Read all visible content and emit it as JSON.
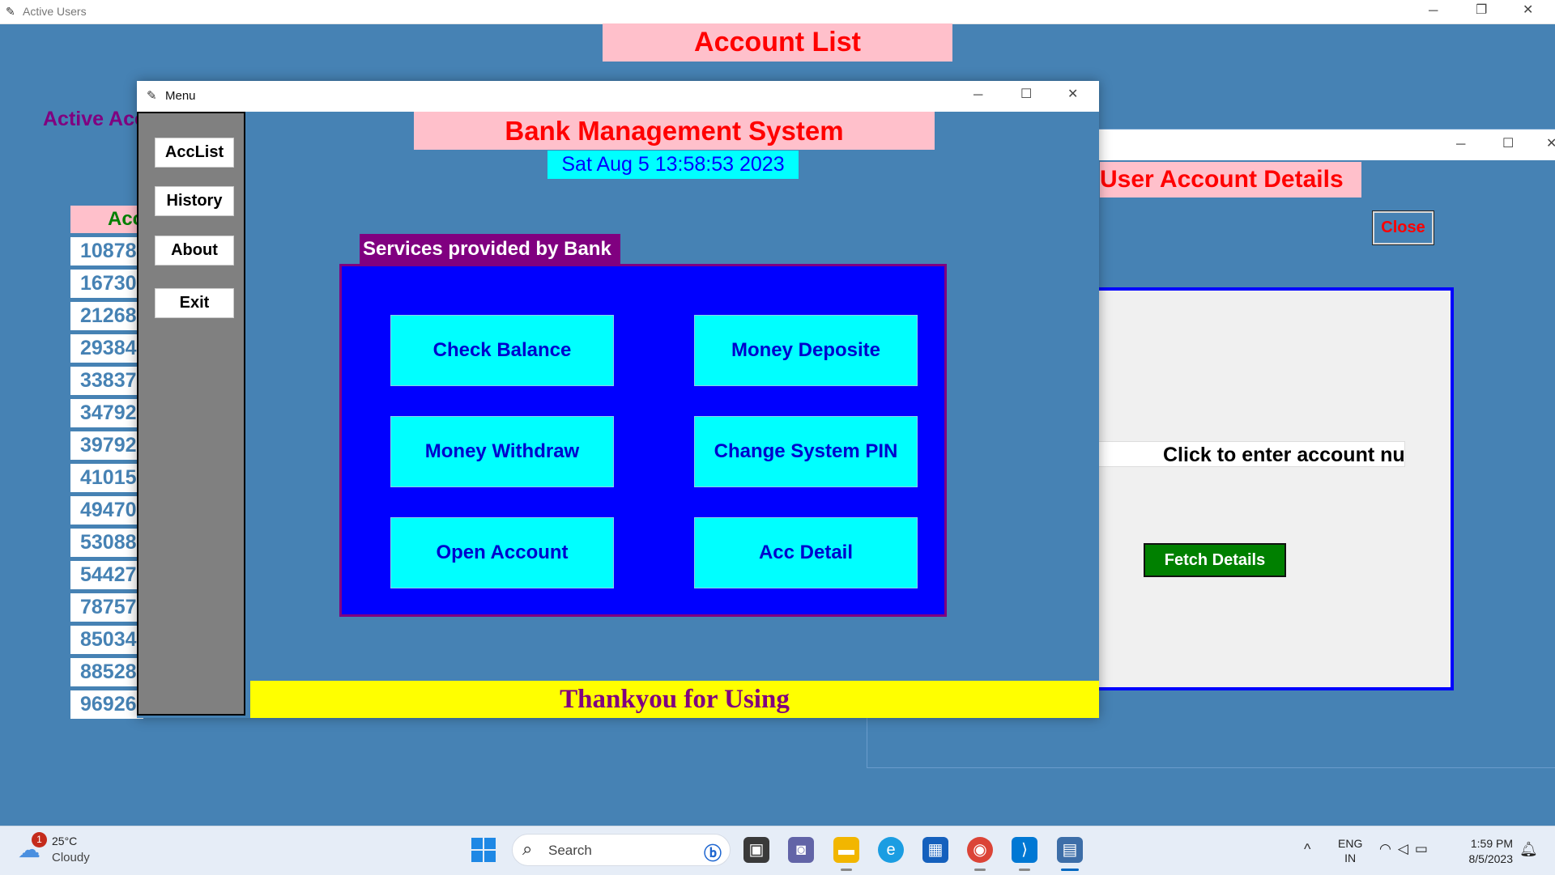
{
  "bg_window": {
    "title": "Active Users",
    "heading": "Account List",
    "active_label": "Active Acc",
    "table": {
      "header": "Acc",
      "rows": [
        "10878",
        "16730",
        "21268",
        "29384",
        "33837",
        "34792",
        "39792",
        "41015",
        "49470",
        "53088",
        "54427",
        "78757",
        "85034",
        "88528",
        "96926"
      ]
    }
  },
  "uad_window": {
    "heading": "User Account Details",
    "close_label": "Close",
    "input_value": "Click to enter account number",
    "fetch_label": "Fetch Details"
  },
  "menu_window": {
    "title": "Menu",
    "sidebar": [
      "AccList",
      "History",
      "About",
      "Exit"
    ],
    "heading": "Bank Management System",
    "datetime": "Sat Aug  5 13:58:53 2023",
    "services_label": "Services provided by Bank",
    "services": [
      "Check Balance",
      "Money Deposite",
      "Money Withdraw",
      "Change System PIN",
      "Open Account",
      "Acc Detail"
    ],
    "footer": "Thankyou for Using"
  },
  "taskbar": {
    "weather_temp": "25°C",
    "weather_condition": "Cloudy",
    "weather_badge": "1",
    "search_placeholder": "Search",
    "lang_line1": "ENG",
    "lang_line2": "IN",
    "time": "1:59 PM",
    "date": "8/5/2023"
  },
  "colors": {
    "background": "#4682b4",
    "heading_bg": "#ffc0cb",
    "heading_fg": "#ff0000",
    "service_panel": "#0000ff",
    "service_button": "#00ffff",
    "footer_bg": "#ffff00",
    "footer_fg": "#800080",
    "fetch_bg": "#008000"
  }
}
